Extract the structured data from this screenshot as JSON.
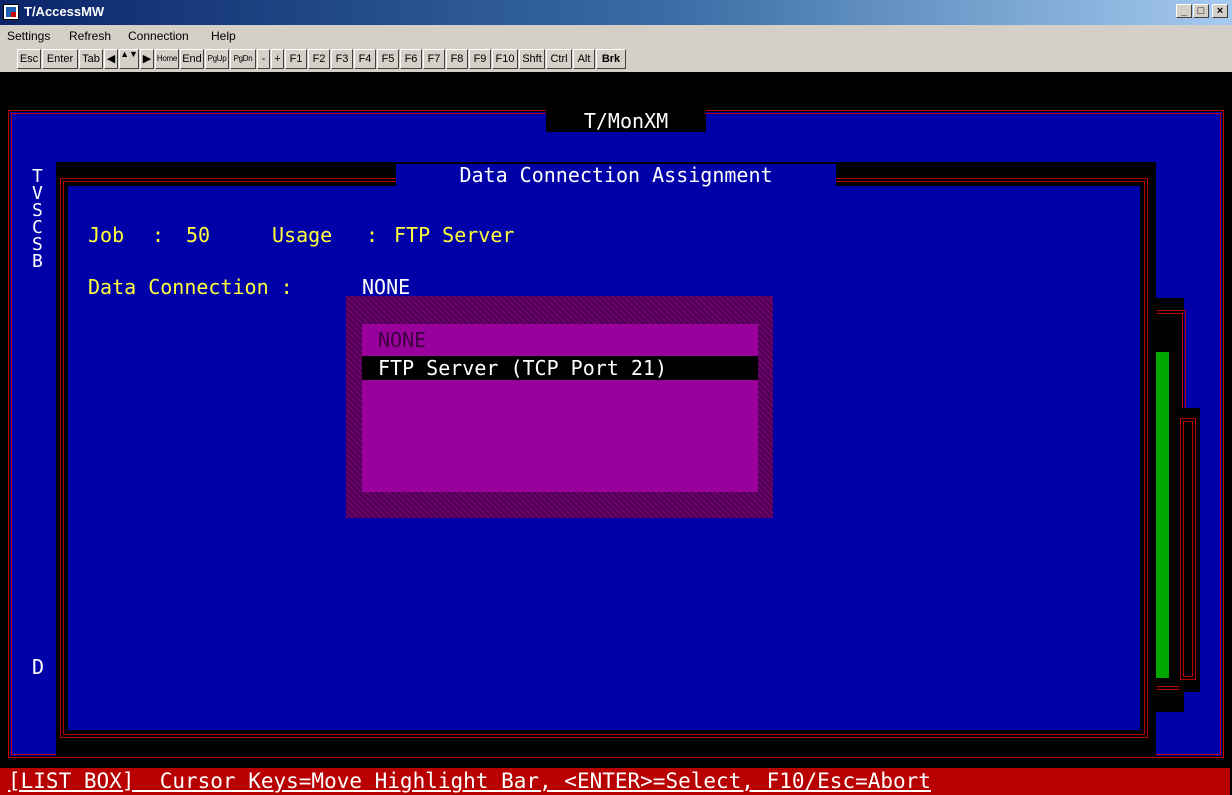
{
  "window": {
    "title": "T/AccessMW",
    "controls": {
      "minimize": "_",
      "maximize": "□",
      "close": "×"
    }
  },
  "menu": {
    "items": [
      "Settings",
      "Refresh",
      "Connection",
      "Help"
    ]
  },
  "toolbar": {
    "buttons": [
      "Esc",
      "Enter",
      "Tab",
      "◀",
      "▲▼",
      "▶",
      "Home",
      "End",
      "PgUp",
      "PgDn",
      "-",
      "+",
      "F1",
      "F2",
      "F3",
      "F4",
      "F5",
      "F6",
      "F7",
      "F8",
      "F9",
      "F10",
      "Shft",
      "Ctrl",
      "Alt",
      "Brk"
    ]
  },
  "terminal": {
    "outer_title": "T/MonXM",
    "side_letters": [
      "T",
      "V",
      "S",
      "C",
      "S",
      "B"
    ],
    "side_letter_bottom": "D",
    "dialog": {
      "title": "Data Connection Assignment",
      "job_label": "Job",
      "job_sep": ":",
      "job_value": "50",
      "usage_label": "Usage",
      "usage_sep": ":",
      "usage_value": "FTP Server",
      "data_conn_label": "Data Connection :",
      "data_conn_value": "NONE"
    },
    "listbox": {
      "options": [
        "NONE",
        "FTP Server (TCP Port 21)"
      ],
      "selected": "FTP Server (TCP Port 21)"
    },
    "status": "[LIST BOX]  Cursor Keys=Move Highlight Bar, <ENTER>=Select, F10/Esc=Abort"
  },
  "colors": {
    "terminal_bg": "#0000a8",
    "frame_border": "#b80000",
    "label_text": "#ffff3c",
    "listbox_bg": "#9a009c",
    "listbox_shadow": "#6e0070",
    "highlight_bg": "#000000",
    "status_bg": "#b80000",
    "side_bar": "#00a800"
  }
}
